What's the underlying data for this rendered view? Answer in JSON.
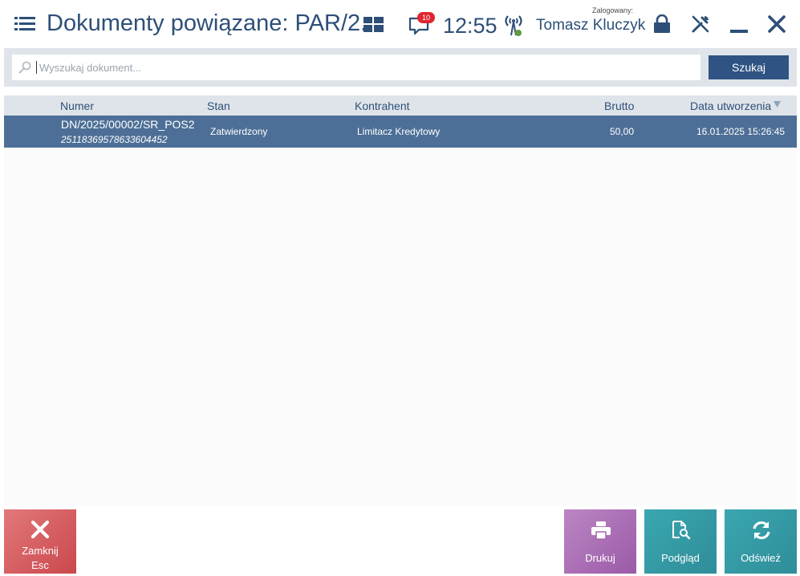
{
  "header": {
    "title": "Dokumenty powiązane: PAR/2...",
    "notifications_count": "10",
    "time": "12:55",
    "logged_label": "Zalogowany:",
    "user_name": "Tomasz Kluczyk"
  },
  "search": {
    "placeholder": "Wyszukaj dokument...",
    "value": "",
    "button_label": "Szukaj"
  },
  "table": {
    "columns": [
      "Numer",
      "Stan",
      "Kontrahent",
      "Brutto",
      "Data utworzenia"
    ],
    "sort_direction": "descending",
    "rows": [
      {
        "numer": "DN/2025/00002/SR_POS2",
        "code": "25118369578633604452",
        "stan": "Zatwierdzony",
        "kontrahent": "Limitacz Kredytowy",
        "brutto": "50,00",
        "data": "16.01.2025 15:26:45"
      }
    ]
  },
  "buttons": {
    "close_label": "Zamknij",
    "close_shortcut": "Esc",
    "print_label": "Drukuj",
    "preview_label": "Podgląd",
    "refresh_label": "Odśwież"
  },
  "colors": {
    "accent": "#2f5483",
    "selected_row": "#4d6f97",
    "close": "#d65c60",
    "print": "#ab70b6",
    "preview": "#3599a3"
  },
  "icons": [
    "menu-icon",
    "tiles-icon",
    "notification-icon",
    "signal-icon",
    "lock-icon",
    "tools-icon",
    "minimize-icon",
    "close-icon",
    "search-icon",
    "sort-down-icon",
    "printer-icon",
    "document-preview-icon",
    "refresh-icon"
  ]
}
